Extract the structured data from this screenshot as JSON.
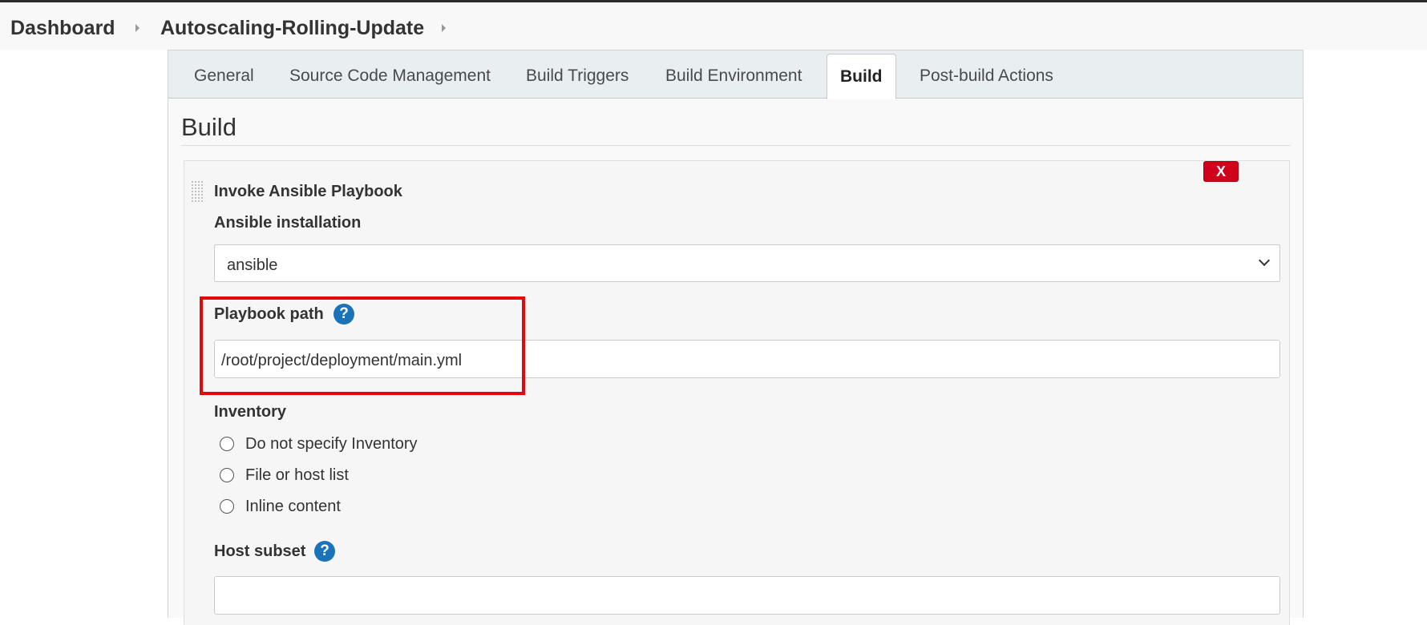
{
  "breadcrumb": {
    "items": [
      "Dashboard",
      "Autoscaling-Rolling-Update"
    ]
  },
  "tabs": [
    {
      "label": "General",
      "active": false
    },
    {
      "label": "Source Code Management",
      "active": false
    },
    {
      "label": "Build Triggers",
      "active": false
    },
    {
      "label": "Build Environment",
      "active": false
    },
    {
      "label": "Build",
      "active": true
    },
    {
      "label": "Post-build Actions",
      "active": false
    }
  ],
  "section": {
    "title": "Build"
  },
  "builder": {
    "title": "Invoke Ansible Playbook",
    "delete_label": "X",
    "ansible_installation": {
      "label": "Ansible installation",
      "value": "ansible"
    },
    "playbook_path": {
      "label": "Playbook path",
      "value": "/root/project/deployment/main.yml",
      "help": "?"
    },
    "inventory": {
      "label": "Inventory",
      "options": [
        "Do not specify Inventory",
        "File or host list",
        "Inline content"
      ]
    },
    "host_subset": {
      "label": "Host subset",
      "value": "",
      "help": "?"
    }
  },
  "colors": {
    "highlight": "#e4080a",
    "delete_button": "#d0021b",
    "help_icon": "#1a73b8",
    "tabbar": "#e9eef1"
  }
}
